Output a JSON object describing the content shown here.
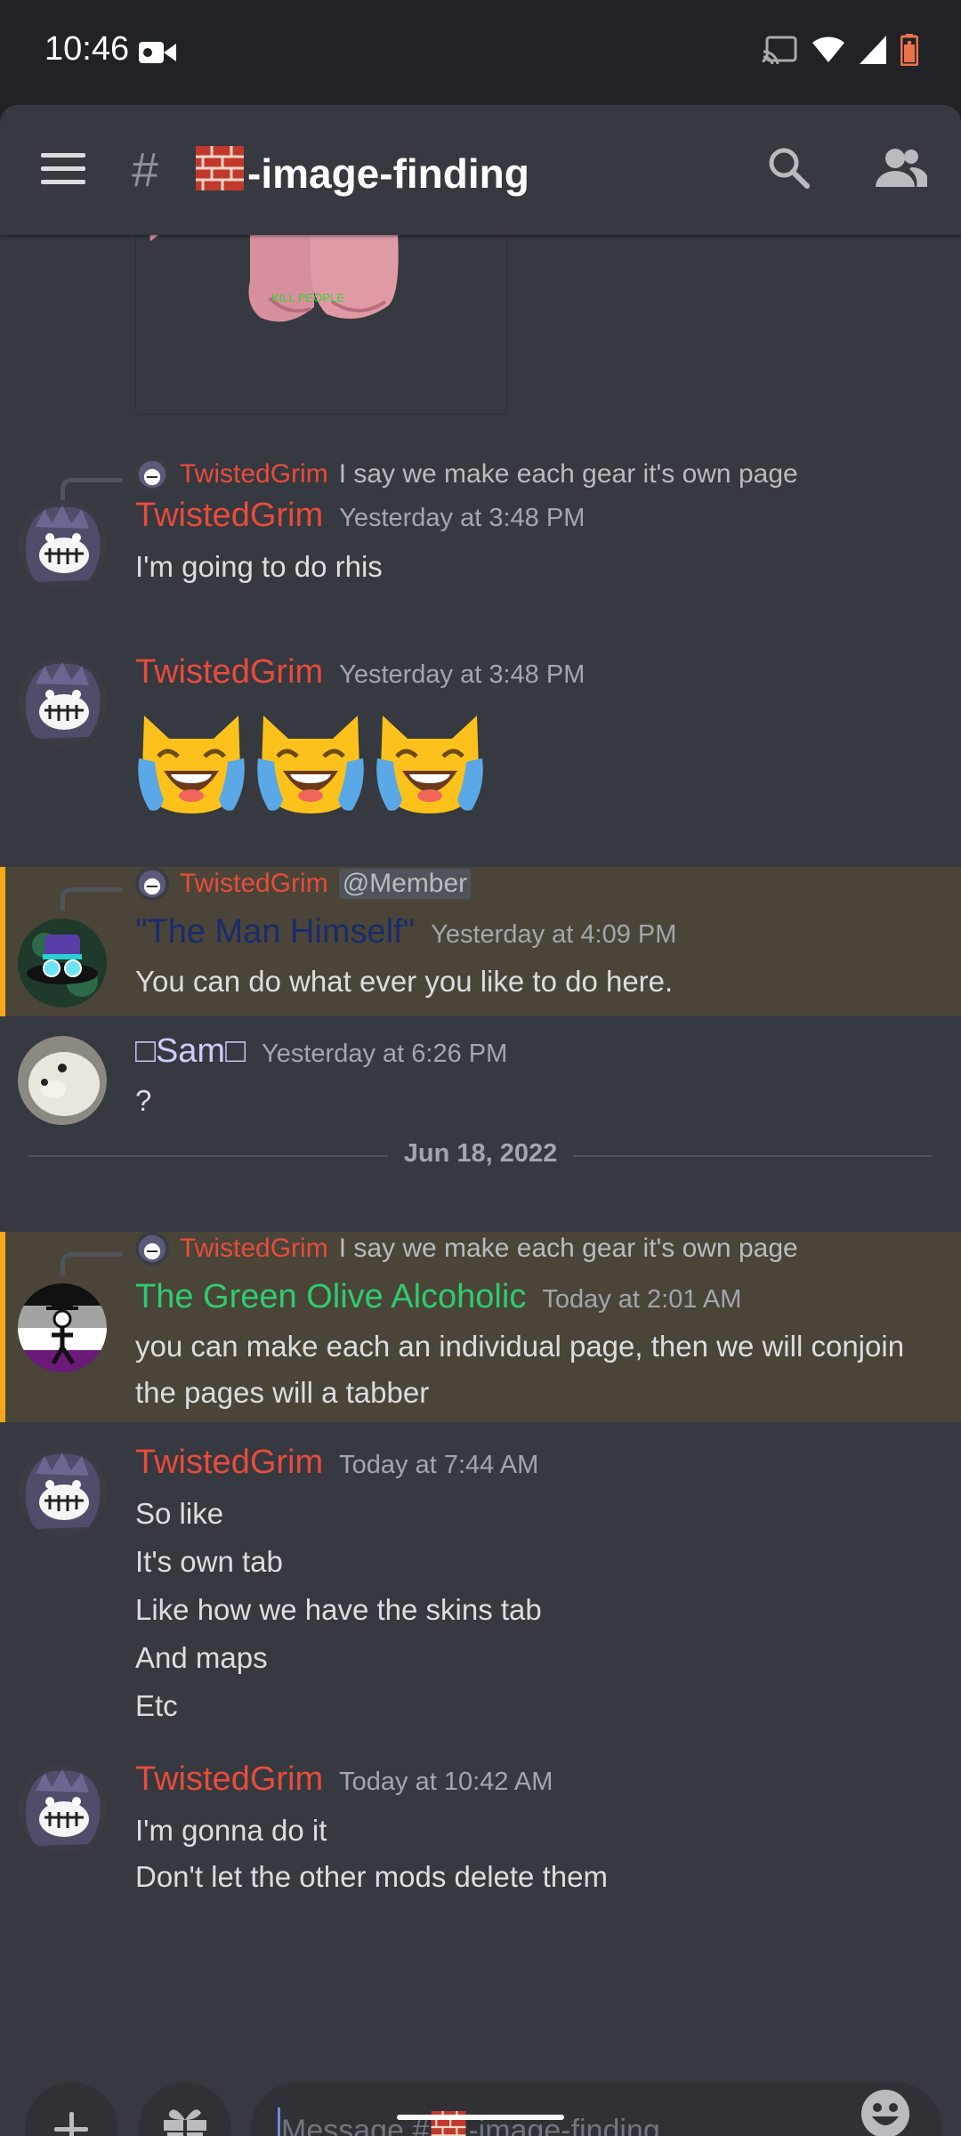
{
  "status_bar": {
    "time": "10:46",
    "icons": [
      "video-camera-icon",
      "cast-icon",
      "wifi-icon",
      "signal-icon",
      "battery-icon"
    ]
  },
  "header": {
    "channel_prefix": "#",
    "channel_name": "-image-finding",
    "channel_emoji": "brick-icon",
    "icons": [
      "hamburger-icon",
      "search-icon",
      "members-icon"
    ]
  },
  "image_embed": {
    "caption": "KILL PEOPLE"
  },
  "messages": [
    {
      "reply_to": {
        "author": "TwistedGrim",
        "text": "I say we make each gear it's own page"
      },
      "author": "TwistedGrim",
      "timestamp": "Yesterday at 3:48 PM",
      "lines": [
        "I'm going to do rhis"
      ]
    },
    {
      "author": "TwistedGrim",
      "timestamp": "Yesterday at 3:48 PM",
      "emoji": [
        "joy-cat-icon",
        "joy-cat-icon",
        "joy-cat-icon"
      ]
    },
    {
      "reply_to": {
        "author": "TwistedGrim",
        "mention": "@Member"
      },
      "author": "\"The Man Himself\"",
      "timestamp": "Yesterday at 4:09 PM",
      "lines": [
        "You can do what ever you like to do here."
      ],
      "highlighted": true
    },
    {
      "author": "□Sam□",
      "timestamp": "Yesterday at 6:26 PM",
      "lines": [
        "?"
      ]
    },
    {
      "reply_to": {
        "author": "TwistedGrim",
        "text": "I say we make each gear it's own page"
      },
      "author": "The Green Olive Alcoholic",
      "timestamp": "Today at 2:01 AM",
      "lines": [
        "you can make each an individual page, then we will conjoin",
        "the pages will a tabber"
      ],
      "highlighted": true
    },
    {
      "author": "TwistedGrim",
      "timestamp": "Today at 7:44 AM",
      "lines": [
        "So like",
        "It's own tab",
        "Like how we have the skins tab",
        "And maps",
        "Etc"
      ]
    },
    {
      "author": "TwistedGrim",
      "timestamp": "Today at 10:42 AM",
      "lines": [
        "I'm gonna do it",
        "Don't let the other mods delete them"
      ]
    }
  ],
  "date_divider": "Jun 18, 2022",
  "composer": {
    "placeholder_prefix": "Message #",
    "placeholder_suffix": "-image-finding",
    "icons": [
      "plus-icon",
      "gift-icon",
      "emoji-icon"
    ]
  },
  "colors": {
    "background": "#36393f",
    "status_bar": "#202225",
    "twistedgrim": "#e74c3c",
    "the_man_himself": "#1a2a6c",
    "sam": "#c9cdfb",
    "green_olive": "#2ecc71",
    "mention_highlight": "#4a4538",
    "mention_bar": "#faa61a"
  }
}
